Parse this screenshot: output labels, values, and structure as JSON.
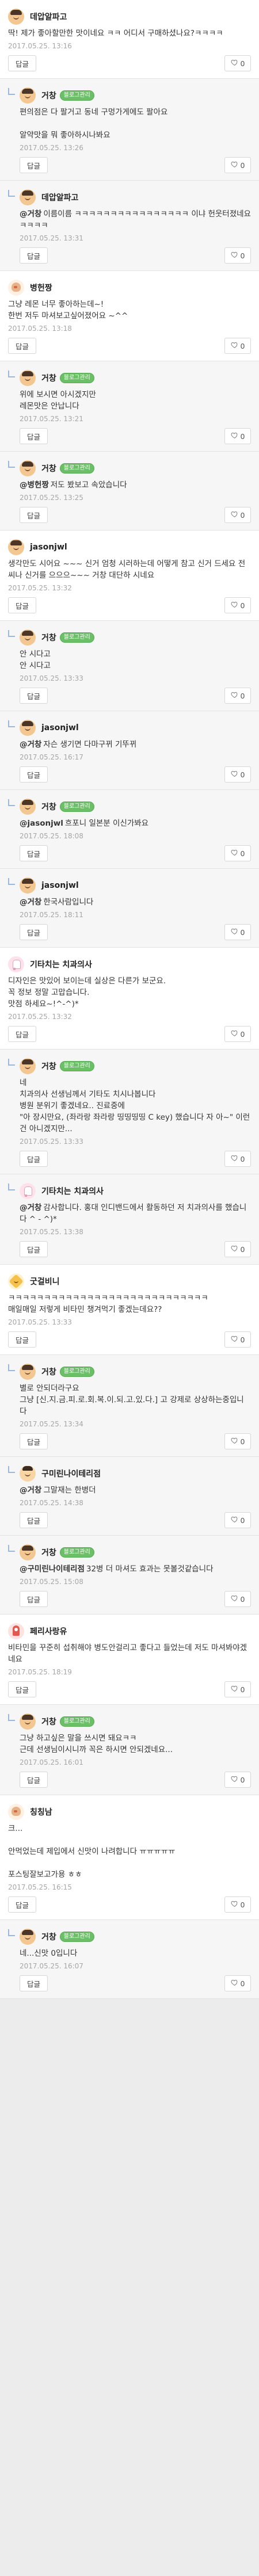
{
  "reply_label": "답글",
  "badge_label": "블로그관리",
  "comments": [
    {
      "avatar": "face",
      "author": "데압알파고",
      "badge": false,
      "reply": false,
      "mention": "",
      "text": "딱! 제가 좋아할만한 맛이네요 ㅋㅋ 어디서 구매하셨나요?ㅋㅋㅋㅋ",
      "date": "2017.05.25. 13:16",
      "likes": "0"
    },
    {
      "avatar": "face",
      "author": "거창",
      "badge": true,
      "reply": true,
      "mention": "",
      "text": "편의점은 다 팔거고 동네 구멍가게에도 팔아요\n\n알약맛을 뭐 좋아하시나봐요",
      "date": "2017.05.25. 13:26",
      "likes": "0"
    },
    {
      "avatar": "face",
      "author": "데압알파고",
      "badge": false,
      "reply": true,
      "mention": "@거창",
      "text": "이름이름 ㅋㅋㅋㅋㅋㅋㅋㅋㅋㅋㅋㅋㅋㅋㅋㅋ 이냐 헌웃터졌네요 ㅋㅋㅋㅋ",
      "date": "2017.05.25. 13:31",
      "likes": "0"
    },
    {
      "avatar": "bird",
      "author": "병헌짱",
      "badge": false,
      "reply": false,
      "mention": "",
      "text": "그냥 레몬 너무 좋아하는데~!\n한번 저두 마셔보고싶어졌어요 ~^^",
      "date": "2017.05.25. 13:18",
      "likes": "0"
    },
    {
      "avatar": "face",
      "author": "거창",
      "badge": true,
      "reply": true,
      "mention": "",
      "text": "위에 보시면 아시겠지만\n레몬맛은 안납니다",
      "date": "2017.05.25. 13:21",
      "likes": "0"
    },
    {
      "avatar": "face",
      "author": "거창",
      "badge": true,
      "reply": true,
      "mention": "@병헌짱",
      "text": "저도 봤보고 속았습니다",
      "date": "2017.05.25. 13:25",
      "likes": "0"
    },
    {
      "avatar": "face",
      "author": "jasonjwl",
      "badge": false,
      "reply": false,
      "mention": "",
      "text": "생각만도 시어요 ~~~ 신거 엄청 시러하는데 어떻게 참고 신거 드세요 전씨나 신거를 으으으~~~ 거창 대단하 시네요",
      "date": "2017.05.25. 13:32",
      "likes": "0"
    },
    {
      "avatar": "face",
      "author": "거창",
      "badge": true,
      "reply": true,
      "mention": "",
      "text": "안 시다고\n안 시다고",
      "date": "2017.05.25. 13:33",
      "likes": "0"
    },
    {
      "avatar": "face",
      "author": "jasonjwl",
      "badge": false,
      "reply": true,
      "mention": "@거창",
      "text": "자슨 생기면 다마구뀌 기뚜뀌",
      "date": "2017.05.25. 16:17",
      "likes": "0"
    },
    {
      "avatar": "face",
      "author": "거창",
      "badge": true,
      "reply": true,
      "mention": "@jasonjwl",
      "text": "흐포니 일본분 이신가봐요",
      "date": "2017.05.25. 18:08",
      "likes": "0"
    },
    {
      "avatar": "face",
      "author": "jasonjwl",
      "badge": false,
      "reply": true,
      "mention": "@거창",
      "text": "한국사람입니다",
      "date": "2017.05.25. 18:11",
      "likes": "0"
    },
    {
      "avatar": "tooth",
      "author": "기타치는 치과의사",
      "badge": false,
      "reply": false,
      "mention": "",
      "text": "디자인은 맛있어 보이는데 실상은 다른가 보군요.\n꼭 정보 정말 고맙습니다.\n맛점 하세요~!^-^)*",
      "date": "2017.05.25. 13:32",
      "likes": "0"
    },
    {
      "avatar": "face",
      "author": "거창",
      "badge": true,
      "reply": true,
      "mention": "",
      "text": "네\n치과의사 선생님께서 기타도 치시나봅니다\n병원 분위기 좋겠네요.. 진료중에\n\"아 장시만요, (좌라랑 좌라랑 띵띵띵띵 C key) 했습니다 자 아~\" 이런건 아니겠지만...",
      "date": "2017.05.25. 13:33",
      "likes": "0"
    },
    {
      "avatar": "tooth",
      "author": "기타치는 치과의사",
      "badge": false,
      "reply": true,
      "mention": "@거창",
      "text": "감사합니다. 홍대 인디밴드에서 활동하던 저 치과의사를 했습니다 ^ - ^)*",
      "date": "2017.05.25. 13:38",
      "likes": "0"
    },
    {
      "avatar": "star",
      "author": "굿걸비니",
      "badge": false,
      "reply": false,
      "mention": "",
      "text": "ㅋㅋㅋㅋㅋㅋㅋㅋㅋㅋㅋㅋㅋㅋㅋㅋㅋㅋㅋㅋㅋㅋㅋㅋㅋㅋㅋㅋ\n매일매일 저렇게 비타민 챙겨먹기 좋겠는데요??",
      "date": "2017.05.25. 13:33",
      "likes": "0"
    },
    {
      "avatar": "face",
      "author": "거창",
      "badge": true,
      "reply": true,
      "mention": "",
      "text": "별로 안되더라구요\n그냥 [신.지.금.피.로.회.복.이.되.고.있.다.] 고 강제로 상상하는중입니다",
      "date": "2017.05.25. 13:34",
      "likes": "0"
    },
    {
      "avatar": "sleepy",
      "author": "구미린나이테리점",
      "badge": false,
      "reply": true,
      "mention": "@거창",
      "text": "그말재는 한병더",
      "date": "2017.05.25. 14:38",
      "likes": "0"
    },
    {
      "avatar": "face",
      "author": "거창",
      "badge": true,
      "reply": true,
      "mention": "@구미린나이테리점",
      "text": "32병 더 마셔도 효과는 못볼것같습니다",
      "date": "2017.05.25. 15:08",
      "likes": "0"
    },
    {
      "avatar": "pin",
      "author": "페리사랑유",
      "badge": false,
      "reply": false,
      "mention": "",
      "text": "비타민을 꾸준히 섭취해야 병도안걸리고 좋다고 들었는데 저도 마셔봐야겠네요",
      "date": "2017.05.25. 18:19",
      "likes": "0"
    },
    {
      "avatar": "face",
      "author": "거창",
      "badge": true,
      "reply": true,
      "mention": "",
      "text": "그냥 하고싶은 말을 쓰시면 돼요ㅋㅋ\n근데 선생님이시니까 꼭은 하시면 안되겠네요...",
      "date": "2017.05.25. 16:01",
      "likes": "0"
    },
    {
      "avatar": "bird",
      "author": "칭칭남",
      "badge": false,
      "reply": false,
      "mention": "",
      "text": "크...\n\n안먹었는데 제입에서 신맛이 나려합니다 ㅠㅠㅠㅠㅠ\n\n포스팅잘보고가용 ㅎㅎ",
      "date": "2017.05.25. 16:15",
      "likes": "0"
    },
    {
      "avatar": "face",
      "author": "거창",
      "badge": true,
      "reply": true,
      "mention": "",
      "text": "네...신맛 0입니다",
      "date": "2017.05.25. 16:07",
      "likes": "0"
    }
  ]
}
